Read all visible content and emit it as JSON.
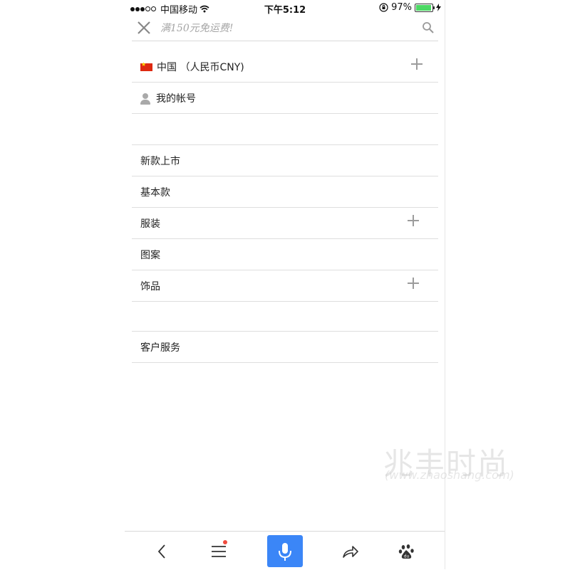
{
  "status_bar": {
    "carrier": "中国移动",
    "time": "下午5:12",
    "battery_percent": "97%",
    "battery_level": 0.97,
    "battery_color": "#4cd964"
  },
  "search": {
    "placeholder": "满150元免运费!",
    "close_icon": "close-icon",
    "search_icon": "search-icon"
  },
  "account_section": {
    "country": "中国 （人民币CNY)",
    "my_account": "我的帐号"
  },
  "menu": {
    "items": [
      {
        "label": "新款上市"
      },
      {
        "label": "基本款"
      },
      {
        "label": "服装"
      },
      {
        "label": "图案"
      },
      {
        "label": "饰品"
      }
    ]
  },
  "service": {
    "label": "客户服务"
  },
  "toolbar": {
    "back_icon": "back-icon",
    "menu_icon": "menu-icon",
    "mic_icon": "microphone-icon",
    "share_icon": "share-icon",
    "baidu_icon": "baidu-paw-icon",
    "accent_color": "#3b86f7"
  },
  "watermark": {
    "text": "兆丰时尚",
    "sub": "(www.zhaoshang.com)"
  }
}
